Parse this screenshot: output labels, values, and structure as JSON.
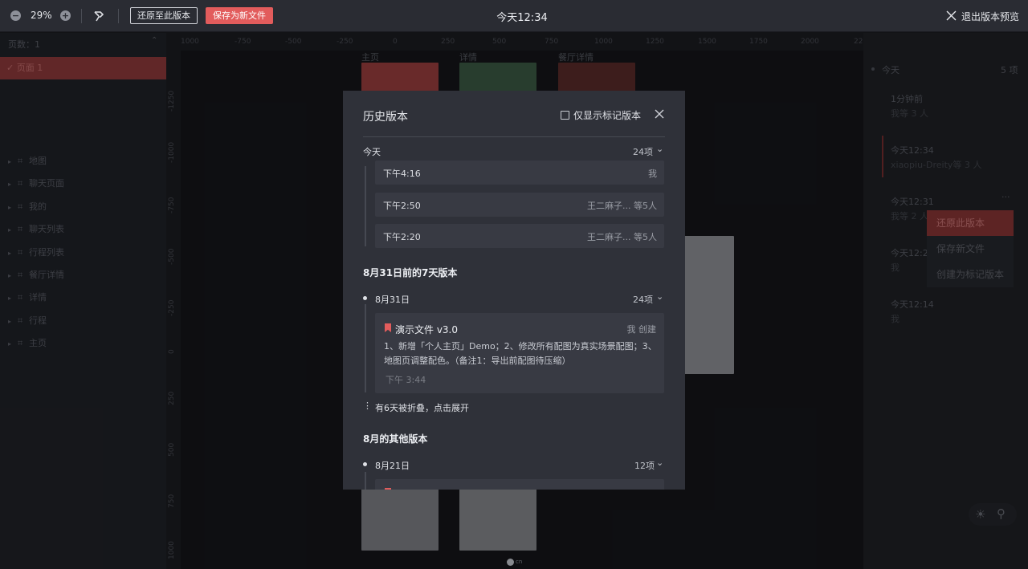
{
  "toolbar": {
    "zoom_out_symbol": "−",
    "zoom_in_symbol": "+",
    "zoom_value": "29%",
    "restore_button": "还原至此版本",
    "save_new_button": "保存为新文件",
    "title": "今天12:34",
    "exit_label": "退出版本预览"
  },
  "left_panel": {
    "pages_header": "页数：1",
    "pages_caret": "⌃",
    "current_page_check": "✓",
    "current_page": "页面 1",
    "layers": [
      "地图",
      "聊天页面",
      "我的",
      "聊天列表",
      "行程列表",
      "餐厅详情",
      "详情",
      "行程",
      "主页"
    ]
  },
  "canvas": {
    "ruler_top": [
      "1000",
      "-750",
      "-500",
      "-250",
      "0",
      "250",
      "500",
      "750",
      "1000",
      "1250",
      "1500",
      "1750",
      "2000",
      "22"
    ],
    "ruler_left": [
      "-1250",
      "-1000",
      "-750",
      "-500",
      "-250",
      "0",
      "250",
      "500",
      "750",
      "1000"
    ],
    "artboard_labels": [
      "主页",
      "详情",
      "餐厅详情"
    ],
    "watermark_text": "cn"
  },
  "right_panel": {
    "group_label": "今天",
    "group_count": "5 项",
    "entries": [
      {
        "time": "1分钟前",
        "who": "我等 3 人"
      },
      {
        "time": "今天12:34",
        "who": "xiaopiu-Dreity等 3 人"
      },
      {
        "time": "今天12:31",
        "who": "我等 2 人",
        "more": "···"
      },
      {
        "time": "今天12:21",
        "who": "我"
      },
      {
        "time": "今天12:14",
        "who": "我"
      }
    ],
    "context_menu": [
      "还原此版本",
      "保存新文件",
      "创建为标记版本"
    ],
    "sun_icon_glyph": "☀",
    "pin_icon_glyph": "⚲"
  },
  "modal": {
    "title": "历史版本",
    "only_marked_label": "仅显示标记版本",
    "today": {
      "label": "今天",
      "count": "24项",
      "chevron": "⌄",
      "rows": [
        {
          "time": "下午4:16",
          "who": "我"
        },
        {
          "time": "下午2:50",
          "who": "王二麻子... 等5人"
        },
        {
          "time": "下午2:20",
          "who": "王二麻子... 等5人"
        }
      ]
    },
    "week_section": {
      "title": "8月31日前的7天版本",
      "date_label": "8月31日",
      "date_count": "24项",
      "version": {
        "title": "演示文件 v3.0",
        "author": "我 创建",
        "description": "1、新增「个人主页」Demo；2、修改所有配图为真实场景配图；3、地图页调整配色。（备注1：导出前配图待压缩）",
        "time": "下午 3:44"
      },
      "fold_icon": "⋮",
      "folded_text": "有6天被折叠，点击展开"
    },
    "other_section": {
      "title": "8月的其他版本",
      "date_label": "8月21日",
      "date_count": "12项"
    }
  },
  "colors": {
    "accent_red": "#e25c5c",
    "toolbar_bg": "#2a2c33",
    "modal_bg": "#2f3139",
    "card_bg": "#383a43"
  }
}
